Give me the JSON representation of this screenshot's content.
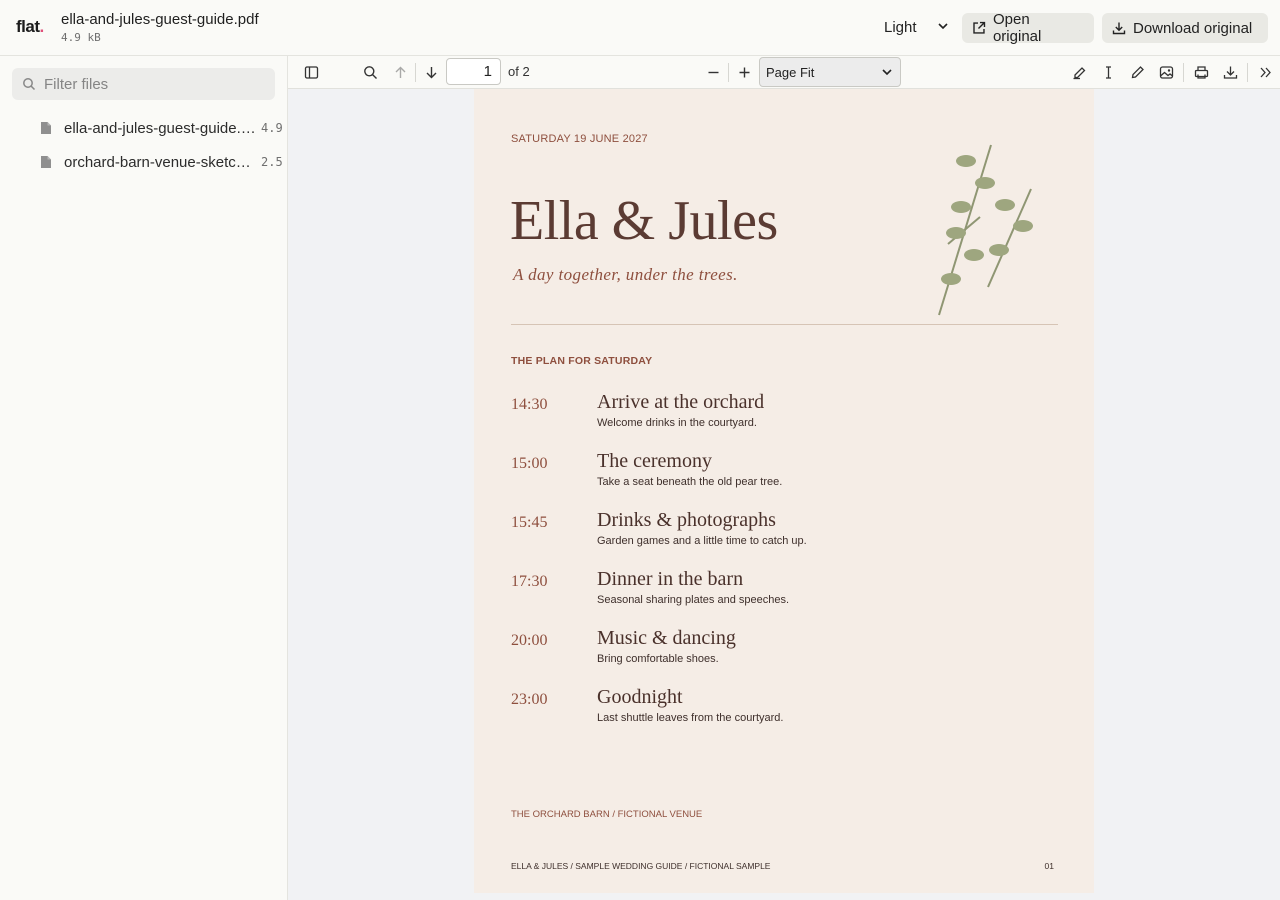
{
  "app": {
    "logo_text": "flat",
    "logo_dot": ".",
    "file_title": "ella-and-jules-guest-guide.pdf",
    "file_size": "4.9 kB"
  },
  "header": {
    "theme_value": "Light",
    "open_original_label": "Open original",
    "download_original_label": "Download original"
  },
  "sidebar": {
    "filter_placeholder": "Filter files",
    "files": [
      {
        "name": "ella-and-jules-guest-guide.pdf",
        "size": "4.9"
      },
      {
        "name": "orchard-barn-venue-sketch.pdf",
        "size": "2.5"
      }
    ]
  },
  "viewer": {
    "page_number": "1",
    "page_count_label": "of 2",
    "zoom_value": "Page Fit"
  },
  "document": {
    "date": "SATURDAY 19 JUNE 2027",
    "title": "Ella & Jules",
    "subtitle": "A day together, under the trees.",
    "section_label": "THE PLAN FOR SATURDAY",
    "events": [
      {
        "time": "14:30",
        "title": "Arrive at the orchard",
        "desc": "Welcome drinks in the courtyard."
      },
      {
        "time": "15:00",
        "title": "The ceremony",
        "desc": "Take a seat beneath the old pear tree."
      },
      {
        "time": "15:45",
        "title": "Drinks & photographs",
        "desc": "Garden games and a little time to catch up."
      },
      {
        "time": "17:30",
        "title": "Dinner in the barn",
        "desc": "Seasonal sharing plates and speeches."
      },
      {
        "time": "20:00",
        "title": "Music & dancing",
        "desc": "Bring comfortable shoes."
      },
      {
        "time": "23:00",
        "title": "Goodnight",
        "desc": "Last shuttle leaves from the courtyard."
      }
    ],
    "venue": "THE ORCHARD BARN / FICTIONAL VENUE",
    "footer_left": "ELLA & JULES / SAMPLE WEDDING GUIDE  /  FICTIONAL SAMPLE",
    "footer_right": "01"
  },
  "colors": {
    "accent_rust": "#8e4f3e",
    "title_brown": "#5b3b33",
    "page_background": "#f5ede6",
    "leaf_green": "#9ea67f",
    "logo_dot": "#e0507a"
  }
}
